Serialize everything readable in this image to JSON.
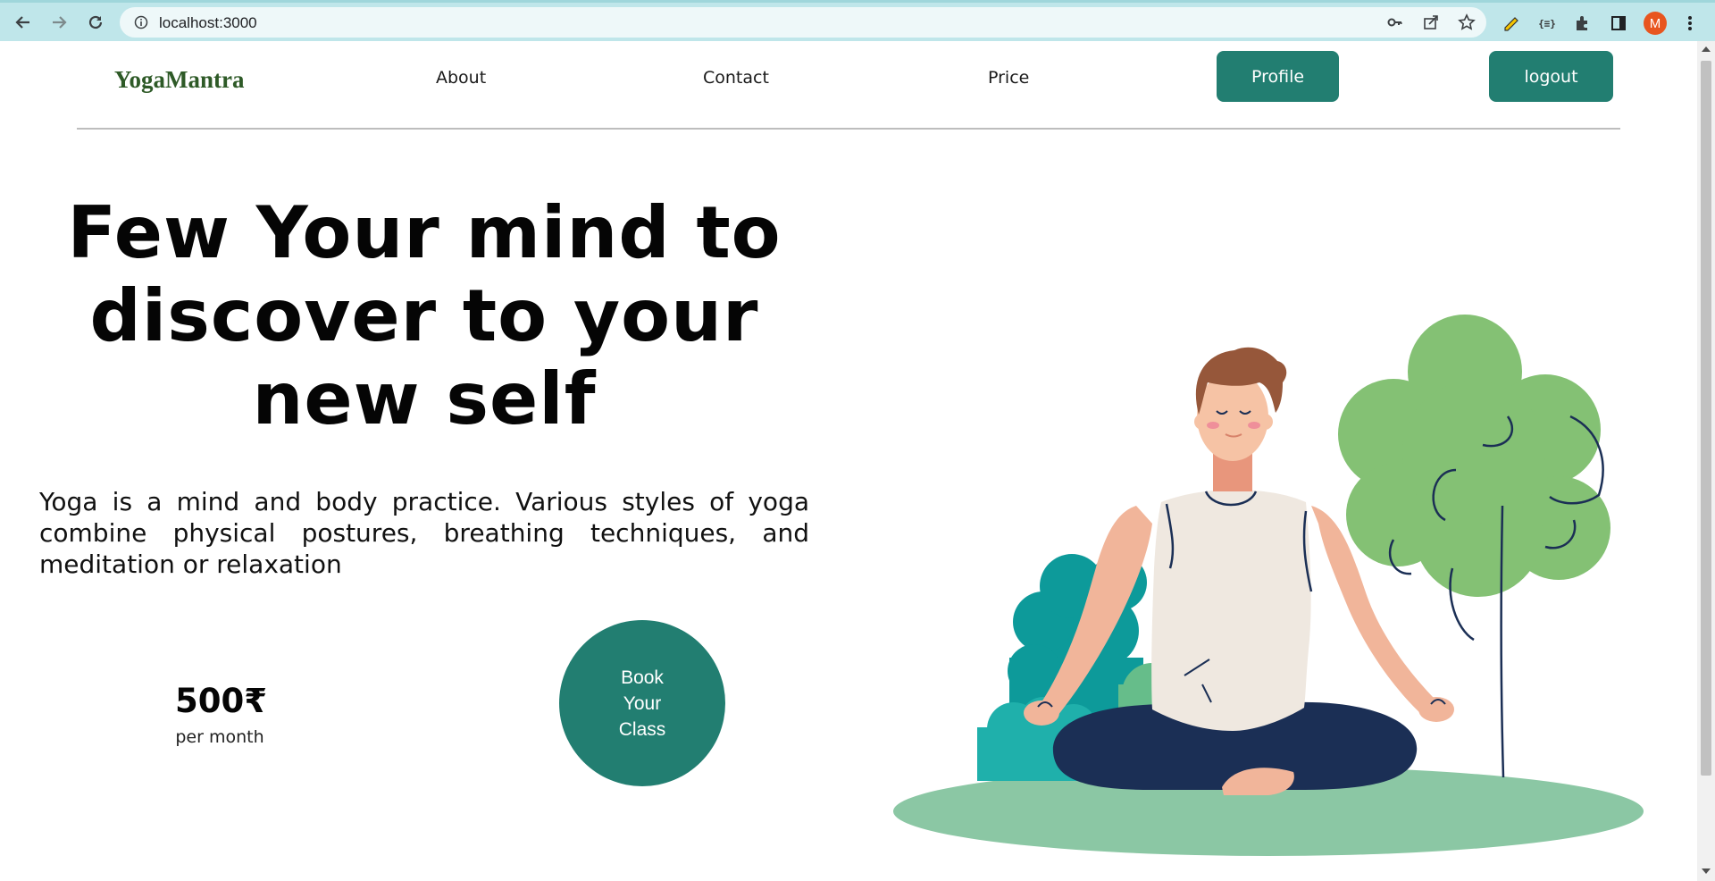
{
  "browser": {
    "url": "localhost:3000",
    "avatar_initial": "M",
    "icons": [
      "back-icon",
      "forward-icon",
      "reload-icon",
      "site-info-icon",
      "key-icon",
      "share-icon",
      "star-icon",
      "pencil-extension-icon",
      "json-extension-icon",
      "puzzle-extension-icon",
      "side-panel-icon",
      "more-icon"
    ]
  },
  "header": {
    "logo": "YogaMantra",
    "nav": [
      {
        "label": "About"
      },
      {
        "label": "Contact"
      },
      {
        "label": "Price"
      }
    ],
    "profile_button": "Profile",
    "logout_button": "logout"
  },
  "hero": {
    "title": "Few Your mind to discover to your new self",
    "description": "Yoga is a mind and body practice. Various styles of yoga combine physical postures, breathing techniques, and meditation or relaxation",
    "price": "500₹",
    "price_period": "per month",
    "cta": "Book Your Class"
  },
  "colors": {
    "brand": "#227e71",
    "logo": "#2e5a27",
    "tree": "#84c174",
    "bush": "#0d9a9a",
    "ground": "#8bc7a4",
    "pants": "#1b2f55",
    "hair": "#96573a"
  }
}
